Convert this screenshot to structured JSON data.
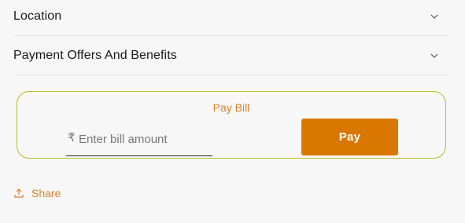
{
  "accordion": {
    "items": [
      {
        "label": "Location",
        "expanded": false
      },
      {
        "label": "Payment Offers And Benefits",
        "expanded": false
      }
    ]
  },
  "pay_bill": {
    "title": "Pay Bill",
    "currency_symbol": "₹",
    "amount_placeholder": "Enter bill amount",
    "amount_value": "",
    "pay_label": "Pay"
  },
  "share": {
    "label": "Share",
    "icon": "share-icon"
  },
  "colors": {
    "accent": "#d97700",
    "accent_text": "#d9822b",
    "card_border": "#b7be2a",
    "background": "#f7f7f7"
  }
}
